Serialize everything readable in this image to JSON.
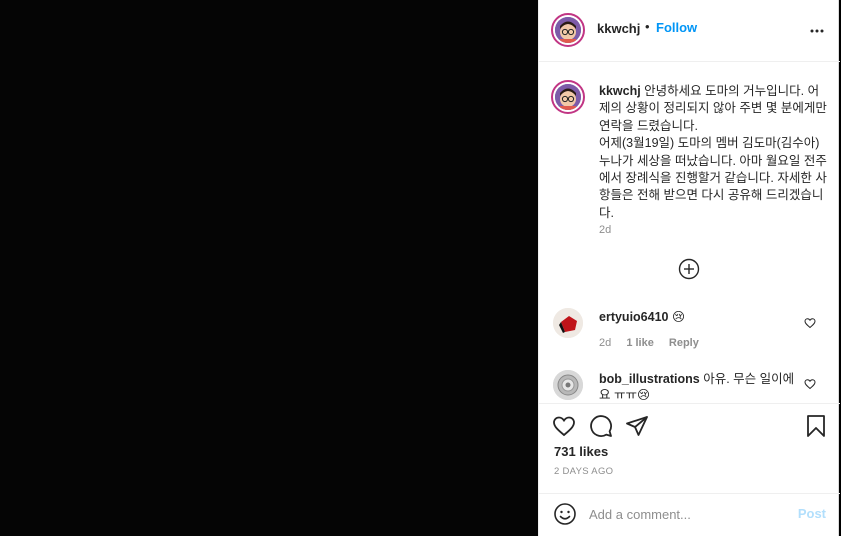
{
  "header": {
    "username": "kkwchj",
    "dot": "•",
    "follow_label": "Follow"
  },
  "caption": {
    "username": "kkwchj",
    "text": "안녕하세요 도마의 거누입니다. 어제의 상황이 정리되지 않아 주변 몇 분에게만 연락을 드렸습니다.\n어제(3월19일) 도마의 멤버 김도마(김수아) 누나가 세상을 떠났습니다. 아마 월요일 전주에서 장례식을 진행할거 같습니다. 자세한 사항들은 전해 받으면 다시 공유해 드리겠습니다.",
    "time": "2d"
  },
  "comments": [
    {
      "username": "ertyuio6410",
      "text": "😢",
      "time": "2d",
      "likes": "1 like",
      "reply_label": "Reply"
    },
    {
      "username": "bob_illustrations",
      "text": "아유. 무슨 일이에요 ㅠㅠ😢"
    }
  ],
  "actions": {
    "likes_count": "731 likes",
    "post_time": "2 DAYS AGO"
  },
  "add_comment": {
    "placeholder": "Add a comment...",
    "post_label": "Post"
  },
  "colors": {
    "accent": "#0095f6",
    "post_disabled": "#b2dffc",
    "muted": "#8e8e8e",
    "text": "#262626"
  },
  "icons": [
    "more-options-icon",
    "load-more-comments-icon",
    "heart-icon",
    "comment-icon",
    "share-icon",
    "bookmark-icon",
    "emoji-icon"
  ]
}
